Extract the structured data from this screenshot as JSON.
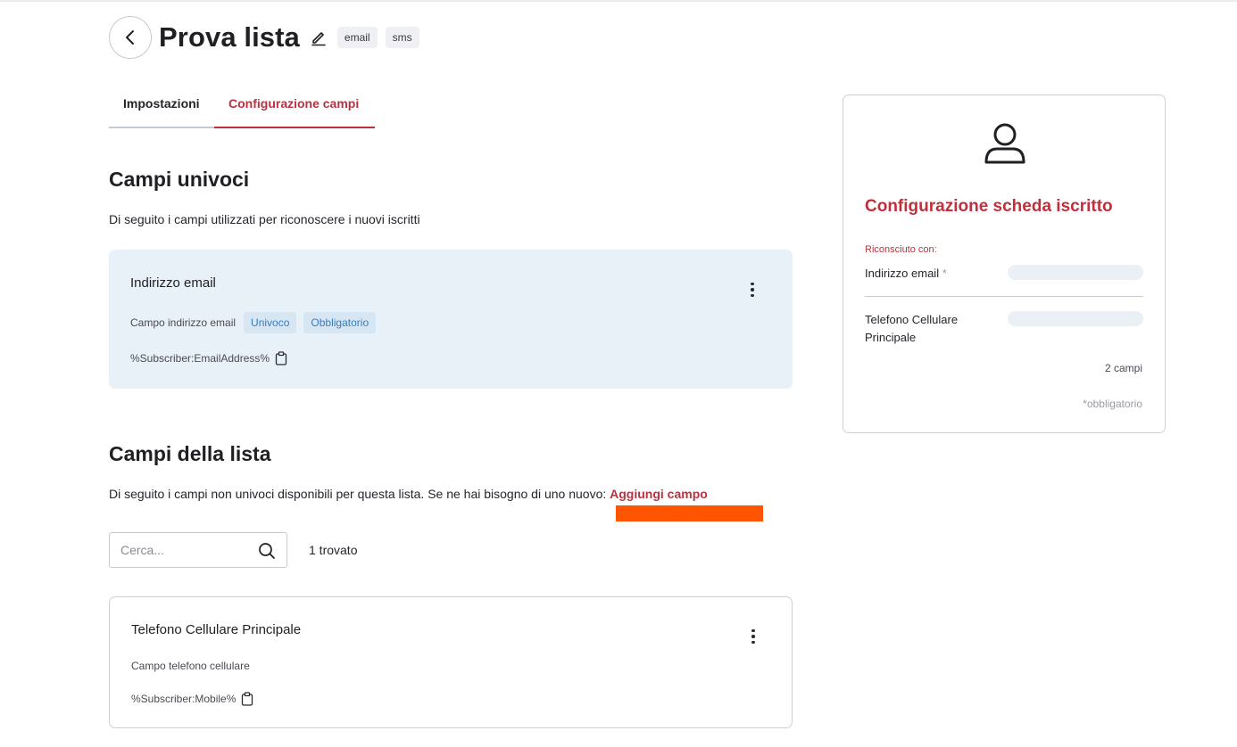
{
  "header": {
    "title": "Prova lista",
    "tags": [
      "email",
      "sms"
    ]
  },
  "tabs": [
    {
      "label": "Impostazioni",
      "active": false
    },
    {
      "label": "Configurazione campi",
      "active": true
    }
  ],
  "unique_fields": {
    "heading": "Campi univoci",
    "description": "Di seguito i campi utilizzati per riconoscere i nuovi iscritti",
    "items": [
      {
        "name": "Indirizzo email",
        "type_label": "Campo indirizzo email",
        "badges": [
          "Univoco",
          "Obbligatorio"
        ],
        "variable": "%Subscriber:EmailAddress%"
      }
    ]
  },
  "list_fields": {
    "heading": "Campi della lista",
    "description": "Di seguito i campi non univoci disponibili per questa lista. Se ne hai bisogno di uno nuovo: ",
    "add_link": "Aggiungi campo",
    "search_placeholder": "Cerca...",
    "found_label": "1 trovato",
    "items": [
      {
        "name": "Telefono Cellulare Principale",
        "type_label": "Campo telefono cellulare",
        "variable": "%Subscriber:Mobile%"
      }
    ]
  },
  "panel": {
    "title": "Configurazione scheda iscritto",
    "recognized_label": "Riconsciuto con:",
    "fields": [
      {
        "label": "Indirizzo email",
        "required_mark": "*"
      },
      {
        "label_line1": "Telefono Cellulare",
        "label_line2": "Principale"
      }
    ],
    "count_label": "2 campi",
    "required_note": "*obbligatorio"
  },
  "colors": {
    "accent": "#c0303c",
    "badge_text": "#3a7bbf",
    "card_bg": "#e8f0f8",
    "highlight": "#ff5500"
  },
  "icons": [
    "chevron-left-icon",
    "pencil-icon",
    "kebab-menu-icon",
    "clipboard-icon",
    "search-icon",
    "user-icon"
  ]
}
